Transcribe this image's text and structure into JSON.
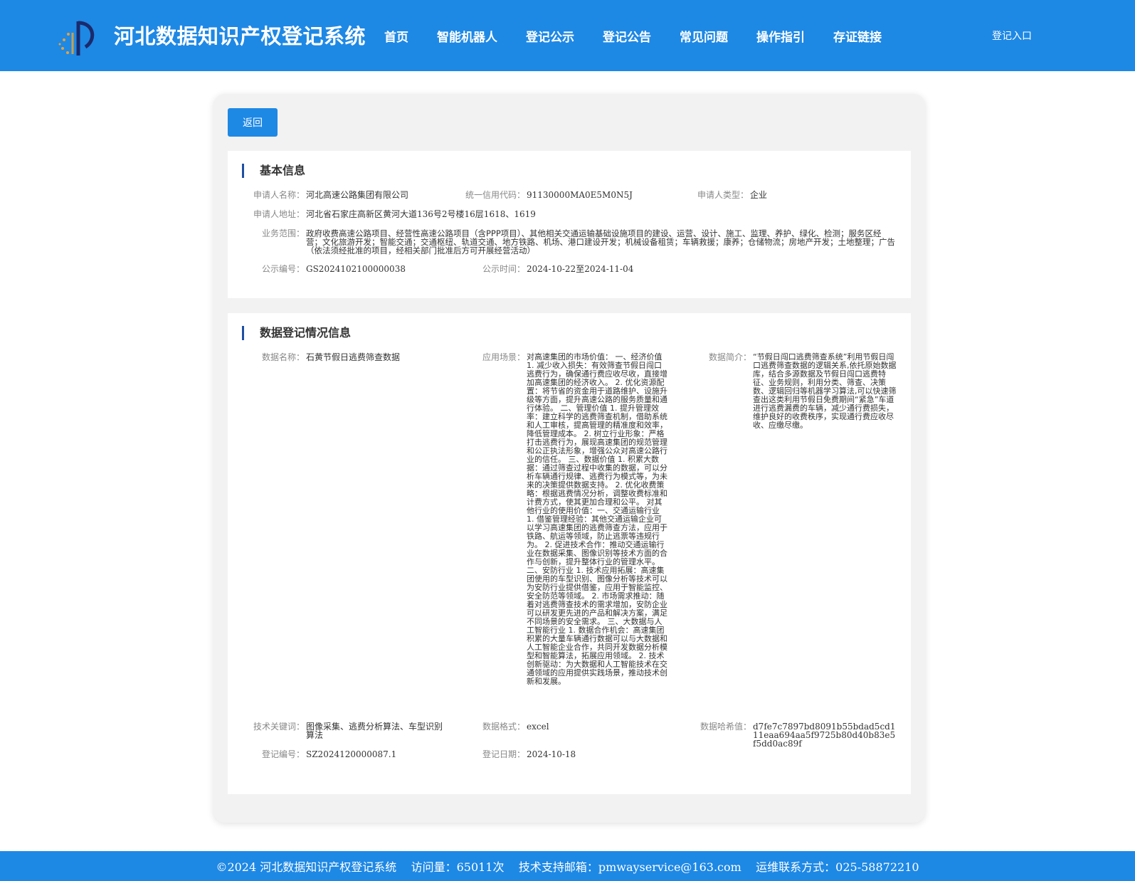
{
  "header": {
    "title": "河北数据知识产权登记系统",
    "nav": [
      "首页",
      "智能机器人",
      "登记公示",
      "登记公告",
      "常见问题",
      "操作指引",
      "存证链接"
    ],
    "login_label": "登记入口"
  },
  "back_label": "返回",
  "basic": {
    "title": "基本信息",
    "applicant_name_label": "申请人名称：",
    "applicant_name": "河北高速公路集团有限公司",
    "credit_code_label": "统一信用代码：",
    "credit_code": "91130000MA0E5M0N5J",
    "applicant_type_label": "申请人类型：",
    "applicant_type": "企业",
    "address_label": "申请人地址：",
    "address": "河北省石家庄高新区黄河大道136号2号楼16层1618、1619",
    "scope_label": "业务范围：",
    "scope": "政府收费高速公路项目、经营性高速公路项目（含PPP项目）、其他相关交通运输基础设施项目的建设、运营、设计、施工、监理、养护、绿化、检测；服务区经营；文化旅游开发；智能交通；交通枢纽、轨道交通、地方铁路、机场、港口建设开发；机械设备租赁；车辆救援；康养；仓储物流；房地产开发；土地整理；广告（依法须经批准的项目，经相关部门批准后方可开展经营活动）",
    "pub_no_label": "公示编号：",
    "pub_no": "GS2024102100000038",
    "pub_time_label": "公示时间：",
    "pub_time": "2024-10-22至2024-11-04"
  },
  "data": {
    "title": "数据登记情况信息",
    "name_label": "数据名称：",
    "name": "石黄节假日逃费筛查数据",
    "scene_label": "应用场景：",
    "scene": "对高速集团的市场价值： 一、经济价值 1. 减少收入损失：有效筛查节假日闯口逃费行为，确保通行费应收尽收，直接增加高速集团的经济收入。 2. 优化资源配置：将节省的资金用于道路维护、设施升级等方面，提升高速公路的服务质量和通行体验。 二、管理价值 1. 提升管理效率：建立科学的逃费筛查机制，借助系统和人工审核，提高管理的精准度和效率，降低管理成本。 2. 树立行业形象：严格打击逃费行为，展现高速集团的规范管理和公正执法形象，增强公众对高速公路行业的信任。 三、数据价值 1. 积累大数据：通过筛查过程中收集的数据，可以分析车辆通行规律、逃费行为模式等，为未来的决策提供数据支持。 2. 优化收费策略：根据逃费情况分析，调整收费标准和计费方式，使其更加合理和公平。 对其他行业的使用价值：一、交通运输行业 1. 借鉴管理经验：其他交通运输企业可以学习高速集团的逃费筛查方法，应用于铁路、航运等领域，防止逃票等违规行为。 2. 促进技术合作：推动交通运输行业在数据采集、图像识别等技术方面的合作与创新，提升整体行业的管理水平。 二、安防行业 1. 技术应用拓展：高速集团使用的车型识别、图像分析等技术可以为安防行业提供借鉴，应用于智能监控、安全防范等领域。 2. 市场需求推动：随着对逃费筛查技术的需求增加，安防企业可以研发更先进的产品和解决方案，满足不同场景的安全需求。 三、大数据与人工智能行业 1. 数据合作机会：高速集团积累的大量车辆通行数据可以与大数据和人工智能企业合作，共同开发数据分析模型和智能算法，拓展应用领域。 2. 技术创新驱动：为大数据和人工智能技术在交通领域的应用提供实践场景，推动技术创新和发展。",
    "intro_label": "数据简介：",
    "intro": "“节假日闯口逃费筛查系统”利用节假日闯口逃费筛查数据的逻辑关系,依托原始数据库，结合多源数据及节假日闯口逃费特征、业务规则，利用分类、筛查、决策数、逻辑回归等机器学习算法,可以快速筛查出这类利用节假日免费期间“紧急”车道进行逃费漏费的车辆，减少通行费损失，维护良好的收费秩序，实现通行费应收尽收、应缴尽缴。",
    "keywords_label": "技术关键词：",
    "keywords": "图像采集、逃费分析算法、车型识别算法",
    "format_label": "数据格式：",
    "format": "excel",
    "hash_label": "数据哈希值：",
    "hash": "d7fe7c7897bd8091b55bdad5cd111eaa694aa5f9725b80d40b83e5f5dd0ac89f",
    "reg_no_label": "登记编号：",
    "reg_no": "SZ2024120000087.1",
    "reg_date_label": "登记日期：",
    "reg_date": "2024-10-18"
  },
  "footer": "©2024 河北数据知识产权登记系统    访问量：65011次    技术支持邮箱：pmwayservice@163.com    运维联系方式：025-58872210",
  "colors": {
    "primary": "#1e88e5",
    "accent_bar": "#1e4fa3"
  }
}
